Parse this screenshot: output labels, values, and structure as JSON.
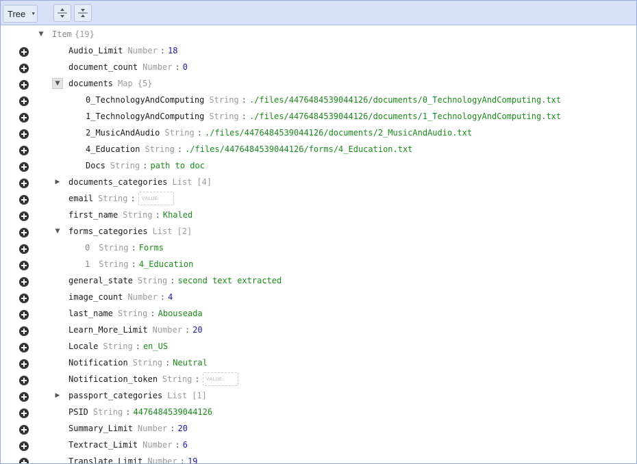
{
  "toolbar": {
    "mode_label": "Tree"
  },
  "root": {
    "key": "Item",
    "count": "{19}"
  },
  "rows": [
    {
      "key": "Audio_Limit",
      "type": "Number",
      "value": "18"
    },
    {
      "key": "document_count",
      "type": "Number",
      "value": "0"
    },
    {
      "key": "documents",
      "type": "Map",
      "count": "{5}"
    },
    {
      "key": "0_TechnologyAndComputing",
      "type": "String",
      "value": "./files/4476484539044126/documents/0_TechnologyAndComputing.txt"
    },
    {
      "key": "1_TechnologyAndComputing",
      "type": "String",
      "value": "./files/4476484539044126/documents/1_TechnologyAndComputing.txt"
    },
    {
      "key": "2_MusicAndAudio",
      "type": "String",
      "value": "./files/4476484539044126/documents/2_MusicAndAudio.txt"
    },
    {
      "key": "4_Education",
      "type": "String",
      "value": "./files/4476484539044126/forms/4_Education.txt"
    },
    {
      "key": "Docs",
      "type": "String",
      "value": "path to doc"
    },
    {
      "key": "documents_categories",
      "type": "List",
      "count": "[4]"
    },
    {
      "key": "email",
      "type": "String",
      "placeholder": "VALUE"
    },
    {
      "key": "first_name",
      "type": "String",
      "value": "Khaled"
    },
    {
      "key": "forms_categories",
      "type": "List",
      "count": "[2]"
    },
    {
      "key": "0",
      "type": "String",
      "value": "Forms"
    },
    {
      "key": "1",
      "type": "String",
      "value": "4_Education"
    },
    {
      "key": "general_state",
      "type": "String",
      "value": "second text extracted"
    },
    {
      "key": "image_count",
      "type": "Number",
      "value": "4"
    },
    {
      "key": "last_name",
      "type": "String",
      "value": "Abouseada"
    },
    {
      "key": "Learn_More_Limit",
      "type": "Number",
      "value": "20"
    },
    {
      "key": "Locale",
      "type": "String",
      "value": "en_US"
    },
    {
      "key": "Notification",
      "type": "String",
      "value": "Neutral"
    },
    {
      "key": "Notification_token",
      "type": "String",
      "placeholder": "VALUE"
    },
    {
      "key": "passport_categories",
      "type": "List",
      "count": "[1]"
    },
    {
      "key": "PSID",
      "type": "String",
      "value": "4476484539044126"
    },
    {
      "key": "Summary_Limit",
      "type": "Number",
      "value": "20"
    },
    {
      "key": "Textract_Limit",
      "type": "Number",
      "value": "6"
    },
    {
      "key": "Translate_Limit",
      "type": "Number",
      "value": "19"
    }
  ]
}
